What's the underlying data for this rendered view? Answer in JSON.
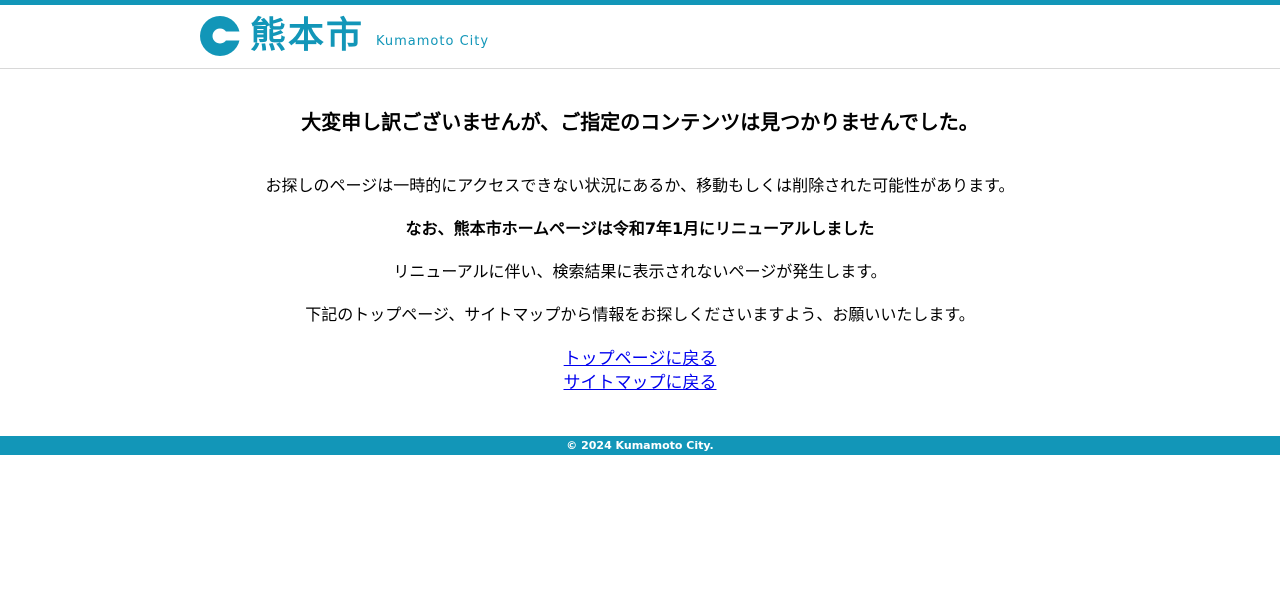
{
  "header": {
    "logo_kanji": "熊本市",
    "logo_roman": "Kumamoto City",
    "accent_color": "#1296b8"
  },
  "main": {
    "title": "大変申し訳ございませんが、ご指定のコンテンツは見つかりませんでした。",
    "message1": "お探しのページは一時的にアクセスできない状況にあるか、移動もしくは削除された可能性があります。",
    "message2": "なお、熊本市ホームページは令和7年1月にリニューアルしました",
    "message3": "リニューアルに伴い、検索結果に表示されないページが発生します。",
    "message4": "下記のトップページ、サイトマップから情報をお探しくださいますよう、お願いいたします。",
    "links": {
      "top_page": "トップページに戻る",
      "sitemap": "サイトマップに戻る"
    }
  },
  "footer": {
    "copyright": "© 2024 Kumamoto City."
  }
}
